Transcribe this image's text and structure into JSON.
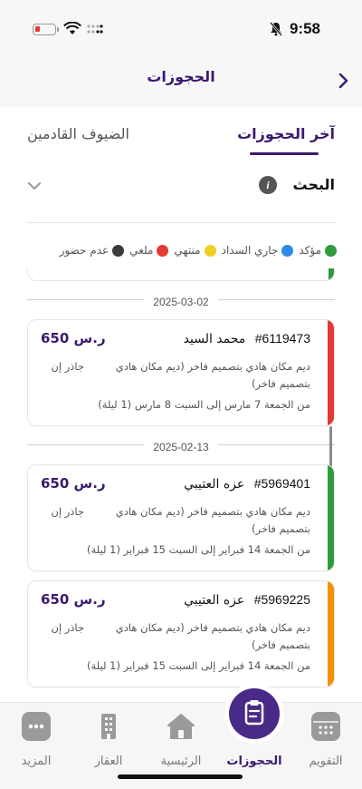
{
  "status_bar": {
    "time": "9:58"
  },
  "nav": {
    "title": "الحجوزات",
    "back_icon": "chevron-right-icon"
  },
  "tabs": {
    "active": "آخر الحجوزات",
    "inactive": "الضيوف القادمين"
  },
  "search": {
    "label": "البحث",
    "info_icon": "info-icon",
    "expand_icon": "chevron-down-icon"
  },
  "legend": [
    {
      "label": "مؤكد",
      "color": "#2e9b3e"
    },
    {
      "label": "جاري السداد",
      "color": "#2f8ae6"
    },
    {
      "label": "منتهي",
      "color": "#f0d020"
    },
    {
      "label": "ملغي",
      "color": "#e53935"
    },
    {
      "label": "عدم حضور",
      "color": "#3a3a3a"
    }
  ],
  "groups": [
    {
      "date": "2025-03-02",
      "bookings": [
        {
          "id": "#6119473",
          "guest": "محمد السيد",
          "price": "650 ر.س",
          "unit": "ديم مكان هادي بتصميم فاخر (ديم مكان هادي بتصميم فاخر)",
          "city": "جاذر إن",
          "dates": "من الجمعة 7 مارس إلى السبت 8 مارس (1 ليلة)",
          "status_color": "#e53935"
        }
      ]
    },
    {
      "date": "2025-02-13",
      "bookings": [
        {
          "id": "#5969401",
          "guest": "عزه العتيبي",
          "price": "650 ر.س",
          "unit": "ديم مكان هادي بتصميم فاخر (ديم مكان هادي بتصميم فاخر)",
          "city": "جاذر إن",
          "dates": "من الجمعة 14 فبراير إلى السبت 15 فبراير (1 ليلة)",
          "status_color": "#2e9b3e"
        },
        {
          "id": "#5969225",
          "guest": "عزه العتيبي",
          "price": "650 ر.س",
          "unit": "ديم مكان هادي بتصميم فاخر (ديم مكان هادي بتصميم فاخر)",
          "city": "جاذر إن",
          "dates": "من الجمعة 14 فبراير إلى السبت 15 فبراير (1 ليلة)",
          "status_color": "#f39200"
        }
      ]
    }
  ],
  "bottom_nav": [
    {
      "label": "التقويم",
      "icon": "calendar-icon"
    },
    {
      "label": "الحجوزات",
      "icon": "clipboard-icon",
      "active": true
    },
    {
      "label": "الرئيسية",
      "icon": "home-icon"
    },
    {
      "label": "العقار",
      "icon": "building-icon"
    },
    {
      "label": "المزيد",
      "icon": "more-icon"
    }
  ]
}
